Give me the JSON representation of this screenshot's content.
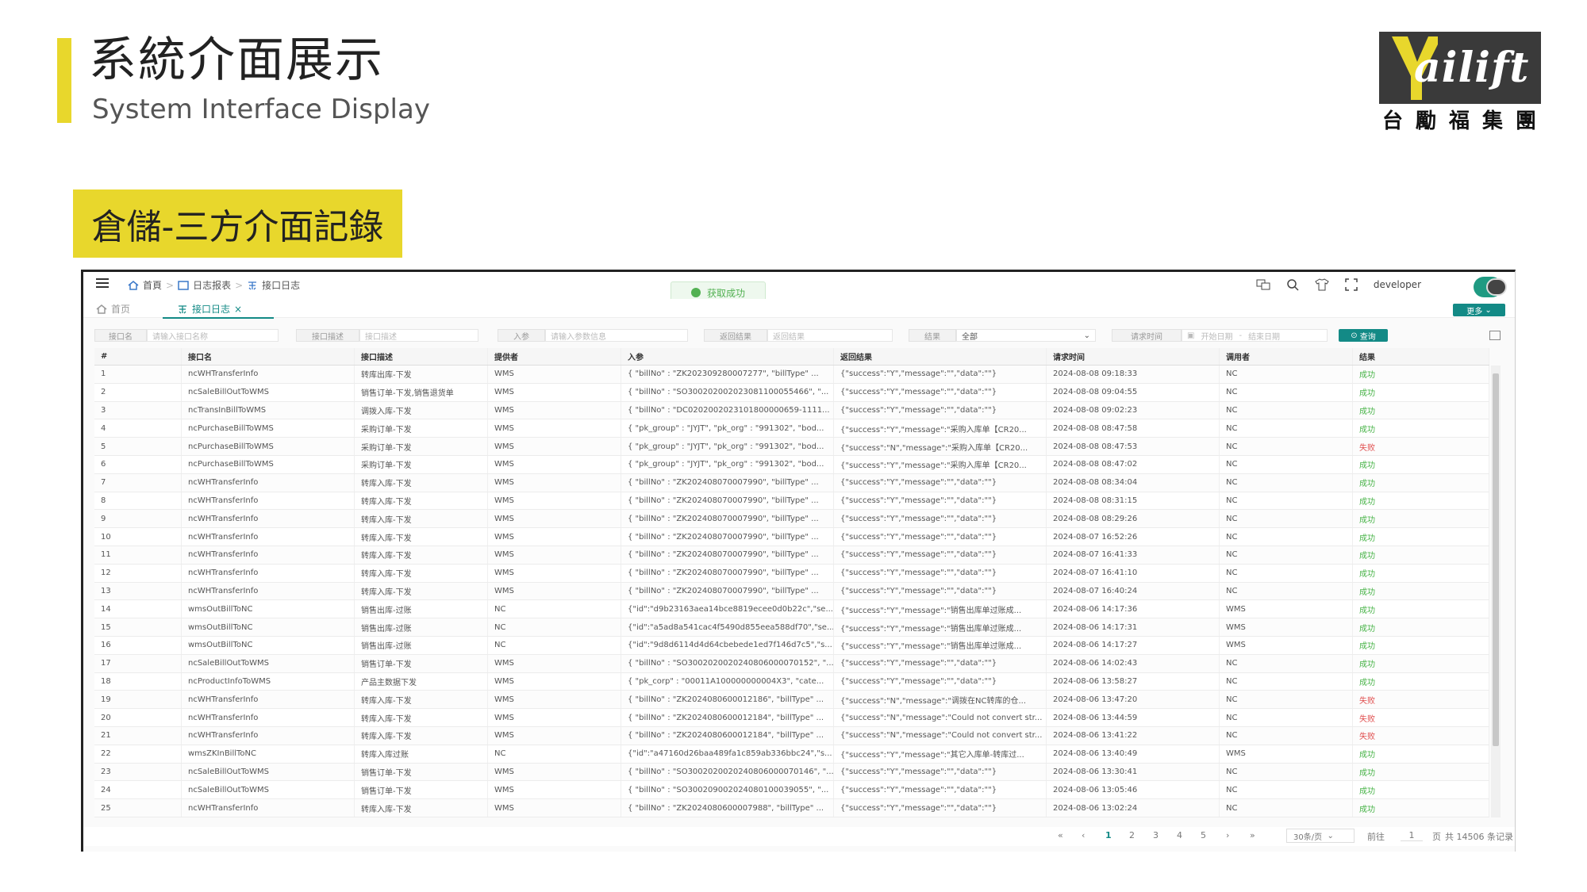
{
  "slide": {
    "title_cn": "系統介面展示",
    "title_en": "System Interface Display",
    "section": "倉儲-三方介面記錄",
    "logo_text": "ailift",
    "logo_cn": [
      "台",
      "勵",
      "福",
      "集",
      "團"
    ]
  },
  "app": {
    "breadcrumb": [
      "首頁",
      "日志报表",
      "接口日志"
    ],
    "toast": "获取成功",
    "user": "developer",
    "tabs": [
      {
        "label": "首页"
      },
      {
        "label": "接口日志"
      }
    ],
    "tab_close": "×",
    "more_label": "更多",
    "filters": {
      "interface_name_label": "接口名",
      "interface_name_placeholder": "请输入接口名称",
      "interface_desc_label": "接口描述",
      "interface_desc_placeholder": "接口描述",
      "input_label": "入参",
      "input_placeholder": "请输入参数信息",
      "return_label": "返回结果",
      "return_placeholder": "返回结果",
      "result_label": "结果",
      "result_value": "全部",
      "time_label": "请求时间",
      "start_placeholder": "开始日期",
      "range_sep": "-",
      "end_placeholder": "结束日期",
      "query_label": "查询"
    },
    "table": {
      "headers": [
        "#",
        "接口名",
        "接口描述",
        "提供者",
        "入参",
        "返回结果",
        "请求时间",
        "调用者",
        "结果"
      ],
      "rows": [
        [
          "1",
          "ncWHTransferInfo",
          "转库出库-下发",
          "WMS",
          "{ \"billNo\" : \"ZK202309280007277\", \"billType\" ...",
          "{\"success\":\"Y\",\"message\":\"\",\"data\":\"\"}",
          "2024-08-08 09:18:33",
          "NC",
          "成功"
        ],
        [
          "2",
          "ncSaleBillOutToWMS",
          "销售订单-下发,销售退货单",
          "WMS",
          "{ \"billNo\" : \"SO3002020020230811000554​66\", \"...",
          "{\"success\":\"Y\",\"message\":\"\",\"data\":\"\"}",
          "2024-08-08 09:04:55",
          "NC",
          "成功"
        ],
        [
          "3",
          "ncTransInBillToWMS",
          "调拨入库-下发",
          "WMS",
          "{ \"billNo\" : \"DC020200202310180000​0659-1111...",
          "{\"success\":\"Y\",\"message\":\"\",\"data\":\"\"}",
          "2024-08-08 09:02:23",
          "NC",
          "成功"
        ],
        [
          "4",
          "ncPurchaseBillToWMS",
          "采购订单-下发",
          "WMS",
          "{ \"pk_group\" : \"JYJT\", \"pk_org\" : \"991302\", \"bod...",
          "{\"success\":\"Y\",\"message\":\"采购入库单【CR20...",
          "2024-08-08 08:47:58",
          "NC",
          "成功"
        ],
        [
          "5",
          "ncPurchaseBillToWMS",
          "采购订单-下发",
          "WMS",
          "{ \"pk_group\" : \"JYJT\", \"pk_org\" : \"991302\", \"bod...",
          "{\"success\":\"N\",\"message\":\"采购入库单【CR20...",
          "2024-08-08 08:47:53",
          "NC",
          "失败"
        ],
        [
          "6",
          "ncPurchaseBillToWMS",
          "采购订单-下发",
          "WMS",
          "{ \"pk_group\" : \"JYJT\", \"pk_org\" : \"991302\", \"bod...",
          "{\"success\":\"Y\",\"message\":\"采购入库单【CR20...",
          "2024-08-08 08:47:02",
          "NC",
          "成功"
        ],
        [
          "7",
          "ncWHTransferInfo",
          "转库入库-下发",
          "WMS",
          "{ \"billNo\" : \"ZK202408070007990\", \"billType\" ...",
          "{\"success\":\"Y\",\"message\":\"\",\"data\":\"\"}",
          "2024-08-08 08:34:04",
          "NC",
          "成功"
        ],
        [
          "8",
          "ncWHTransferInfo",
          "转库入库-下发",
          "WMS",
          "{ \"billNo\" : \"ZK202408070007990\", \"billType\" ...",
          "{\"success\":\"Y\",\"message\":\"\",\"data\":\"\"}",
          "2024-08-08 08:31:15",
          "NC",
          "成功"
        ],
        [
          "9",
          "ncWHTransferInfo",
          "转库入库-下发",
          "WMS",
          "{ \"billNo\" : \"ZK202408070007990\", \"billType\" ...",
          "{\"success\":\"Y\",\"message\":\"\",\"data\":\"\"}",
          "2024-08-08 08:29:26",
          "NC",
          "成功"
        ],
        [
          "10",
          "ncWHTransferInfo",
          "转库入库-下发",
          "WMS",
          "{ \"billNo\" : \"ZK202408070007990\", \"billType\" ...",
          "{\"success\":\"Y\",\"message\":\"\",\"data\":\"\"}",
          "2024-08-07 16:52:26",
          "NC",
          "成功"
        ],
        [
          "11",
          "ncWHTransferInfo",
          "转库入库-下发",
          "WMS",
          "{ \"billNo\" : \"ZK202408070007990\", \"billType\" ...",
          "{\"success\":\"Y\",\"message\":\"\",\"data\":\"\"}",
          "2024-08-07 16:41:33",
          "NC",
          "成功"
        ],
        [
          "12",
          "ncWHTransferInfo",
          "转库入库-下发",
          "WMS",
          "{ \"billNo\" : \"ZK202408070007990\", \"billType\" ...",
          "{\"success\":\"Y\",\"message\":\"\",\"data\":\"\"}",
          "2024-08-07 16:41:10",
          "NC",
          "成功"
        ],
        [
          "13",
          "ncWHTransferInfo",
          "转库入库-下发",
          "WMS",
          "{ \"billNo\" : \"ZK202408070007990\", \"billType\" ...",
          "{\"success\":\"Y\",\"message\":\"\",\"data\":\"\"}",
          "2024-08-07 16:40:24",
          "NC",
          "成功"
        ],
        [
          "14",
          "wmsOutBillToNC",
          "销售出库-过账",
          "NC",
          "{\"id\":\"d9b23163aea14bce8819ecee0d0b22c\",\"se...",
          "{\"success\":\"Y\",\"message\":\"销售出库单过账成...",
          "2024-08-06 14:17:36",
          "WMS",
          "成功"
        ],
        [
          "15",
          "wmsOutBillToNC",
          "销售出库-过账",
          "NC",
          "{\"id\":\"a5ad8a541cac4f5490d855eea588df70\",\"se...",
          "{\"success\":\"Y\",\"message\":\"销售出库单过账成...",
          "2024-08-06 14:17:31",
          "WMS",
          "成功"
        ],
        [
          "16",
          "wmsOutBillToNC",
          "销售出库-过账",
          "NC",
          "{\"id\":\"9d8d6114d4d64cbebede1ed7f146d7c5\",\"s...",
          "{\"success\":\"Y\",\"message\":\"销售出库单过账成...",
          "2024-08-06 14:17:27",
          "WMS",
          "成功"
        ],
        [
          "17",
          "ncSaleBillOutToWMS",
          "销售订单-下发",
          "WMS",
          "{ \"billNo\" : \"SO30020200202408060000​70152\", \"...",
          "{\"success\":\"Y\",\"message\":\"\",\"data\":\"\"}",
          "2024-08-06 14:02:43",
          "NC",
          "成功"
        ],
        [
          "18",
          "ncProductInfoToWMS",
          "产品主数据下发",
          "WMS",
          "{ \"pk_corp\" : \"00011A100000000004X3\", \"cate...",
          "{\"success\":\"Y\",\"message\":\"\",\"data\":\"\"}",
          "2024-08-06 13:58:27",
          "NC",
          "成功"
        ],
        [
          "19",
          "ncWHTransferInfo",
          "转库入库-下发",
          "WMS",
          "{ \"billNo\" : \"ZK202408060001​2186\", \"billType\" ...",
          "{\"success\":\"N\",\"message\":\"调拨在NC转库的仓...",
          "2024-08-06 13:47:20",
          "NC",
          "失败"
        ],
        [
          "20",
          "ncWHTransferInfo",
          "转库入库-下发",
          "WMS",
          "{ \"billNo\" : \"ZK202408060001​2184\", \"billType\" ...",
          "{\"success\":\"N\",\"message\":\"Could not convert str...",
          "2024-08-06 13:44:59",
          "NC",
          "失败"
        ],
        [
          "21",
          "ncWHTransferInfo",
          "转库入库-下发",
          "WMS",
          "{ \"billNo\" : \"ZK202408060001​2184\", \"billType\" ...",
          "{\"success\":\"N\",\"message\":\"Could not convert str...",
          "2024-08-06 13:41:22",
          "NC",
          "失败"
        ],
        [
          "22",
          "wmsZKInBillToNC",
          "转库入库过账",
          "NC",
          "{\"id\":\"a47160d26baa489fa1c859ab336bbc24\",\"s...",
          "{\"success\":\"Y\",\"message\":\"其它入库单-转库过...",
          "2024-08-06 13:40:49",
          "WMS",
          "成功"
        ],
        [
          "23",
          "ncSaleBillOutToWMS",
          "销售订单-下发",
          "WMS",
          "{ \"billNo\" : \"SO30020200202408060000​70146\", \"...",
          "{\"success\":\"Y\",\"message\":\"\",\"data\":\"\"}",
          "2024-08-06 13:30:41",
          "NC",
          "成功"
        ],
        [
          "24",
          "ncSaleBillOutToWMS",
          "销售订单-下发",
          "WMS",
          "{ \"billNo\" : \"SO30020900202408010003​9055\", \"...",
          "{\"success\":\"Y\",\"message\":\"\",\"data\":\"\"}",
          "2024-08-06 13:05:46",
          "NC",
          "成功"
        ],
        [
          "25",
          "ncWHTransferInfo",
          "转库入库-下发",
          "WMS",
          "{ \"billNo\" : \"ZK202408060000​7988\", \"billType\" ...",
          "{\"success\":\"Y\",\"message\":\"\",\"data\":\"\"}",
          "2024-08-06 13:02:24",
          "NC",
          "成功"
        ]
      ]
    },
    "pagination": {
      "first": "«",
      "prev": "‹",
      "pages": [
        "1",
        "2",
        "3",
        "4",
        "5"
      ],
      "current": "1",
      "next": "›",
      "last": "»",
      "page_size": "30条/页",
      "goto_label": "前往",
      "goto_value": "1",
      "page_unit": "页",
      "total": "共 14506 条记录"
    }
  }
}
